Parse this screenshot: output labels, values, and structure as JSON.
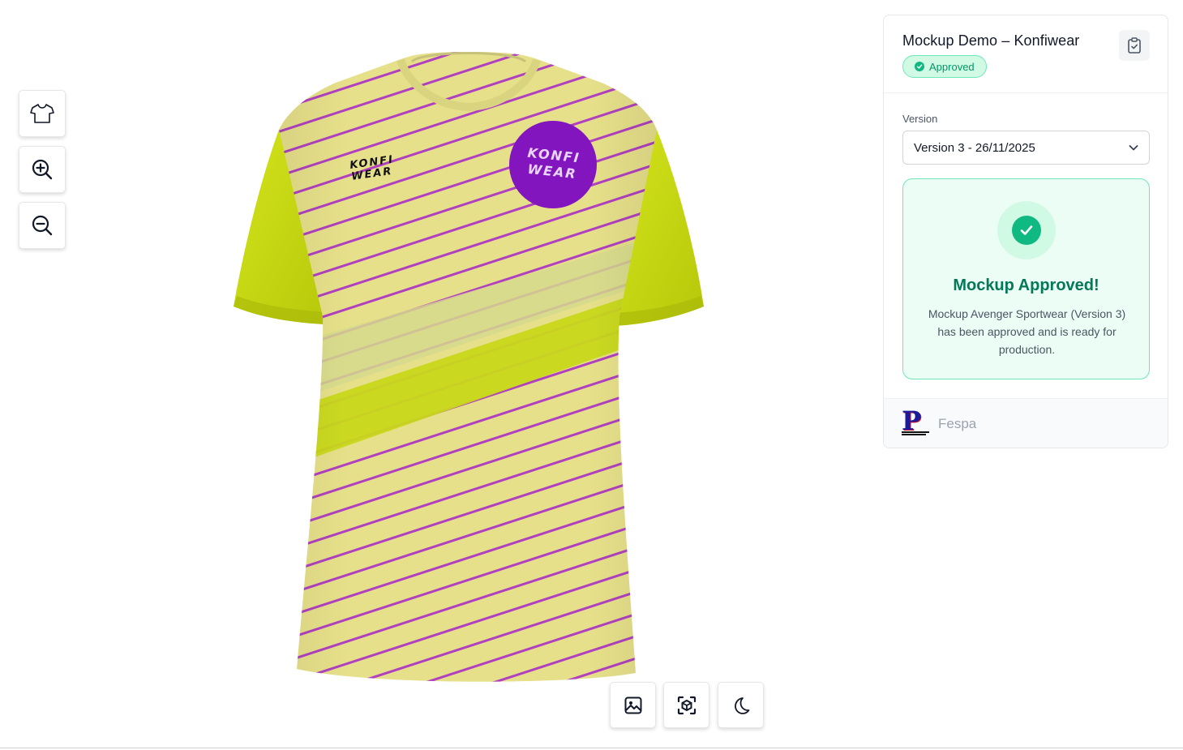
{
  "viewer": {
    "left_toolbar": [
      {
        "icon": "tshirt-icon",
        "action": "shirt"
      },
      {
        "icon": "zoom-in-icon",
        "action": "zoom-in"
      },
      {
        "icon": "zoom-out-icon",
        "action": "zoom-out"
      }
    ],
    "bottom_toolbar": [
      {
        "icon": "image-icon"
      },
      {
        "icon": "ar-view-icon"
      },
      {
        "icon": "moon-icon"
      }
    ],
    "garment": {
      "logo_text_line1": "KONFI",
      "logo_text_line2": "WEAR",
      "colors": {
        "body": "#e6e08a",
        "stripe": "#b040c0",
        "sleeve": "#c8dc10",
        "badge": "#8a18c8"
      }
    }
  },
  "panel": {
    "title": "Mockup Demo – Konfiwear",
    "status_badge": "Approved",
    "version_label": "Version",
    "version_selected": "Version 3 - 26/11/2025",
    "approved_title": "Mockup Approved!",
    "approved_text": "Mockup Avenger Sportwear (Version 3) has been approved and is ready for production.",
    "footer_brand": "Fespa"
  },
  "colors": {
    "accent_green": "#10b981",
    "approved_text_green": "#047857"
  }
}
